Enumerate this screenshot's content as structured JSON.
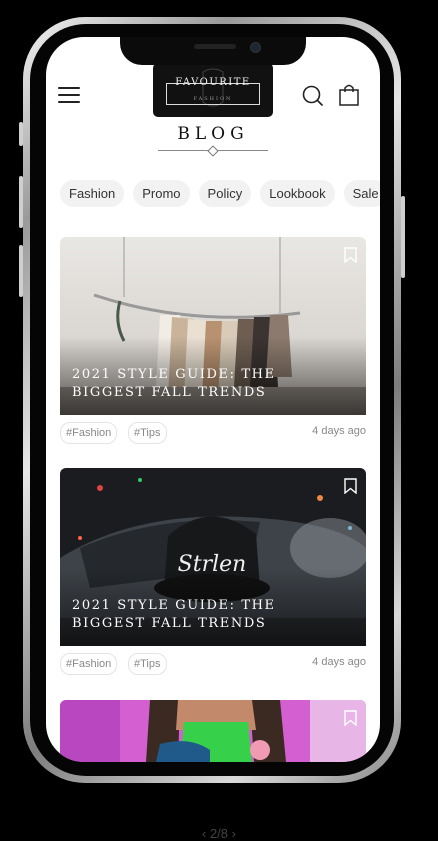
{
  "header": {
    "logo_main": "FAVOURITE",
    "logo_sub": "FASHION"
  },
  "page": {
    "title": "BLOG"
  },
  "categories": [
    "Fashion",
    "Promo",
    "Policy",
    "Lookbook",
    "Sale"
  ],
  "posts": [
    {
      "title": "2021 Style Guide: The Biggest Fall Trends",
      "tags": [
        "#Fashion",
        "#Tips"
      ],
      "time": "4 days ago",
      "image": "clothing-rack-photo"
    },
    {
      "title": "2021 Style Guide: The Biggest Fall Trends",
      "tags": [
        "#Fashion",
        "#Tips"
      ],
      "time": "4 days ago",
      "image": "cap-car-photo"
    },
    {
      "image": "pink-wall-portrait-photo"
    }
  ],
  "pager": "‹ 2/8 ›",
  "icons": [
    "menu-icon",
    "search-icon",
    "bag-icon",
    "bookmark-icon"
  ],
  "colors": {
    "background": "#000000",
    "screen": "#ffffff",
    "chip": "#f2f2f2",
    "logo_bg": "#111111"
  }
}
